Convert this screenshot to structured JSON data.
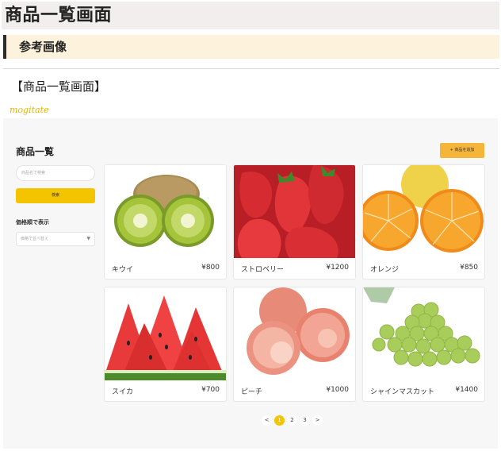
{
  "doc": {
    "title": "商品一覧画面",
    "section_heading": "参考画像",
    "caption": "【商品一覧画面】",
    "logo_text": "mogitate"
  },
  "app": {
    "title": "商品一覧",
    "add_button_label": "+ 商品を追加",
    "search_placeholder": "商品名で検索",
    "search_button_label": "検索",
    "sort_label": "価格順で表示",
    "sort_placeholder": "価格で並べ替え"
  },
  "products": [
    {
      "name": "キウイ",
      "price": "¥800",
      "icon": "kiwi-image"
    },
    {
      "name": "ストロベリー",
      "price": "¥1200",
      "icon": "strawberry-image"
    },
    {
      "name": "オレンジ",
      "price": "¥850",
      "icon": "orange-image"
    },
    {
      "name": "スイカ",
      "price": "¥700",
      "icon": "watermelon-image"
    },
    {
      "name": "ピーチ",
      "price": "¥1000",
      "icon": "peach-image"
    },
    {
      "name": "シャインマスカット",
      "price": "¥1400",
      "icon": "grape-image"
    }
  ],
  "pagination": {
    "prev": "<",
    "pages": [
      "1",
      "2",
      "3"
    ],
    "next": ">",
    "current": "1"
  },
  "colors": {
    "accent": "#f5c400",
    "add_button": "#f5b43a",
    "logo": "#e7b400"
  }
}
